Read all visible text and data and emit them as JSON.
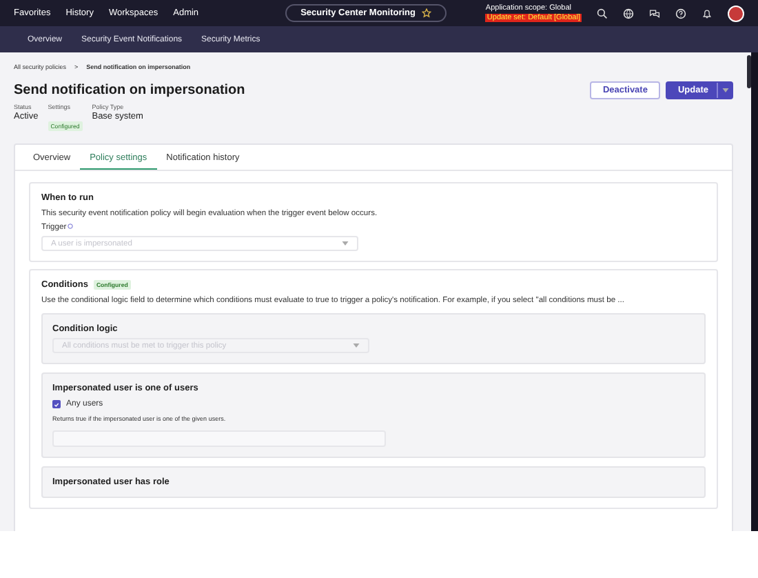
{
  "top_nav": {
    "items": [
      "Favorites",
      "History",
      "Workspaces",
      "Admin"
    ],
    "title": "Security Center Monitoring",
    "scope": "Application scope: Global",
    "update_set": "Update set: Default [Global]"
  },
  "sub_nav": {
    "items": [
      "Overview",
      "Security Event Notifications",
      "Security Metrics"
    ]
  },
  "breadcrumb": {
    "items": [
      "All security policies",
      "Send notification on impersonation"
    ],
    "separator": ">"
  },
  "header": {
    "title": "Send notification on impersonation",
    "buttons": [
      {
        "label": "Deactivate",
        "kind": "secondary"
      },
      {
        "label": "Update",
        "kind": "primary"
      }
    ]
  },
  "meta": [
    {
      "label": "Status",
      "value": "Active",
      "kind": "text"
    },
    {
      "label": "Settings",
      "value": "Configured",
      "kind": "badge"
    },
    {
      "label": "Policy Type",
      "value": "Base system",
      "kind": "text"
    }
  ],
  "tabs": [
    {
      "label": "Overview",
      "selected": false
    },
    {
      "label": "Policy settings",
      "selected": true
    },
    {
      "label": "Notification history",
      "selected": false
    }
  ],
  "when_to_run": {
    "title": "When to run",
    "description": "This security event notification policy will begin evaluation when the trigger event below occurs.",
    "trigger_label": "Trigger",
    "trigger_value": "A user is impersonated",
    "disabled": true
  },
  "conditions": {
    "title": "Conditions",
    "badge": "Configured",
    "description": "Use the conditional logic field to determine which conditions must evaluate to true to trigger a policy's notification. For example, if you select \"all conditions must be ...",
    "logic": {
      "title": "Condition logic",
      "value": "All conditions must be met to trigger this policy",
      "disabled": true
    },
    "sections": [
      {
        "title": "Impersonated user is one of users",
        "checkbox": {
          "label": "Any users",
          "checked": true
        },
        "help": "Returns true if the impersonated user is one of the given users."
      },
      {
        "title": "Impersonated user has role"
      }
    ]
  }
}
